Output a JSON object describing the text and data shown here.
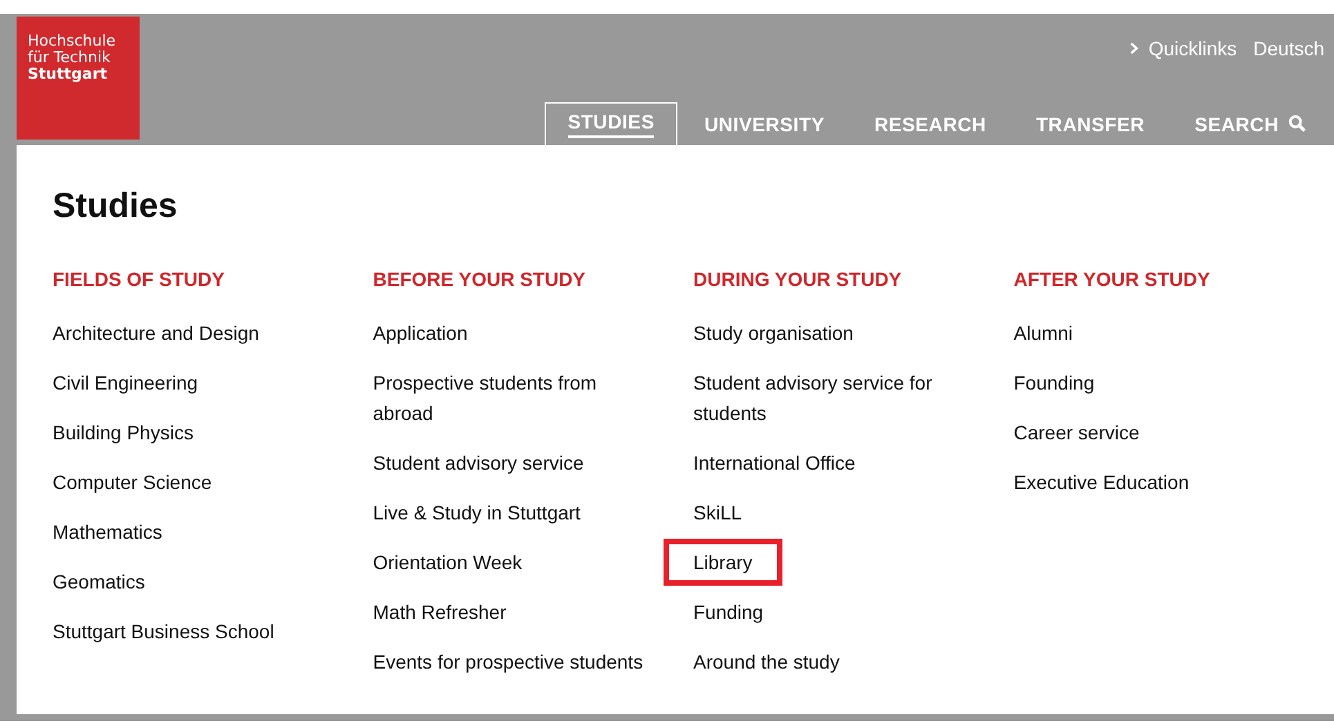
{
  "logo": {
    "lines": [
      "Hochschule",
      "für Technik",
      "Stuttgart"
    ]
  },
  "top_links": [
    {
      "label": "Quicklinks",
      "kind": "menu"
    },
    {
      "label": "Deutsch",
      "kind": "plain"
    }
  ],
  "nav": [
    {
      "label": "STUDIES",
      "selected": true
    },
    {
      "label": "UNIVERSITY",
      "selected": false
    },
    {
      "label": "RESEARCH",
      "selected": false
    },
    {
      "label": "TRANSFER",
      "selected": false
    },
    {
      "label": "SEARCH",
      "selected": false,
      "kind": "search"
    }
  ],
  "title": "Studies",
  "columns": [
    {
      "heading": "FIELDS OF STUDY",
      "items": [
        {
          "label": "Architecture and Design",
          "highlighted": false
        },
        {
          "label": "Civil Engineering",
          "highlighted": false
        },
        {
          "label": "Building Physics",
          "highlighted": false
        },
        {
          "label": "Computer Science",
          "highlighted": false
        },
        {
          "label": "Mathematics",
          "highlighted": false
        },
        {
          "label": "Geomatics",
          "highlighted": false
        },
        {
          "label": "Stuttgart Business School",
          "highlighted": false
        }
      ]
    },
    {
      "heading": "BEFORE YOUR STUDY",
      "items": [
        {
          "label": "Application",
          "highlighted": false
        },
        {
          "label": "Prospective students from abroad",
          "highlighted": false
        },
        {
          "label": "Student advisory service",
          "highlighted": false
        },
        {
          "label": "Live & Study in Stuttgart",
          "highlighted": false
        },
        {
          "label": "Orientation Week",
          "highlighted": false
        },
        {
          "label": "Math Refresher",
          "highlighted": false
        },
        {
          "label": "Events for prospective students",
          "highlighted": false
        }
      ]
    },
    {
      "heading": "DURING YOUR STUDY",
      "items": [
        {
          "label": "Study organisation",
          "highlighted": false
        },
        {
          "label": "Student advisory service for students",
          "highlighted": false
        },
        {
          "label": "International Office",
          "highlighted": false
        },
        {
          "label": "SkiLL",
          "highlighted": false
        },
        {
          "label": "Library",
          "highlighted": true
        },
        {
          "label": "Funding",
          "highlighted": false
        },
        {
          "label": "Around the study",
          "highlighted": false
        }
      ]
    },
    {
      "heading": "AFTER YOUR STUDY",
      "items": [
        {
          "label": "Alumni",
          "highlighted": false
        },
        {
          "label": "Founding",
          "highlighted": false
        },
        {
          "label": "Career service",
          "highlighted": false
        },
        {
          "label": "Executive Education",
          "highlighted": false
        }
      ]
    }
  ]
}
